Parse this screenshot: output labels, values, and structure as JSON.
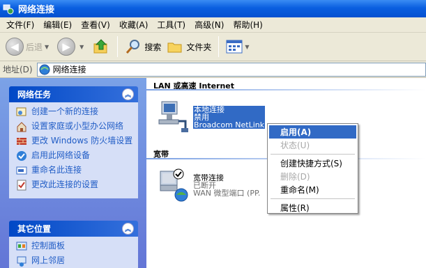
{
  "window": {
    "title": "网络连接"
  },
  "menubar": [
    "文件(F)",
    "编辑(E)",
    "查看(V)",
    "收藏(A)",
    "工具(T)",
    "高级(N)",
    "帮助(H)"
  ],
  "toolbar": {
    "back": "后退",
    "search": "搜索",
    "folders": "文件夹"
  },
  "address": {
    "label": "地址(D)",
    "value": "网络连接"
  },
  "tasks": {
    "network": {
      "title": "网络任务",
      "items": [
        "创建一个新的连接",
        "设置家庭或小型办公网络",
        "更改 Windows 防火墙设置",
        "启用此网络设备",
        "重命名此连接",
        "更改此连接的设置"
      ]
    },
    "other": {
      "title": "其它位置",
      "items": [
        "控制面板",
        "网上邻居"
      ]
    }
  },
  "groups": {
    "lan": {
      "title": "LAN 或高速 Internet",
      "connection": {
        "name": "本地连接",
        "status": "禁用",
        "device": "Broadcom NetLink"
      }
    },
    "broadband": {
      "title": "宽带",
      "connection": {
        "name": "宽带连接",
        "status": "已断开",
        "device": "WAN 微型端口 (PP."
      }
    }
  },
  "context_menu": {
    "items": [
      {
        "label": "启用(A)",
        "state": "highlighted"
      },
      {
        "label": "状态(U)",
        "state": "disabled"
      },
      {
        "label": "创建快捷方式(S)",
        "state": "normal"
      },
      {
        "label": "删除(D)",
        "state": "disabled"
      },
      {
        "label": "重命名(M)",
        "state": "normal"
      },
      {
        "label": "属性(R)",
        "state": "normal"
      }
    ]
  },
  "colors": {
    "title_bar": "#0a5fe0",
    "selection": "#316ac5",
    "task_pane": "#7ba2e7",
    "link": "#215dc6"
  }
}
